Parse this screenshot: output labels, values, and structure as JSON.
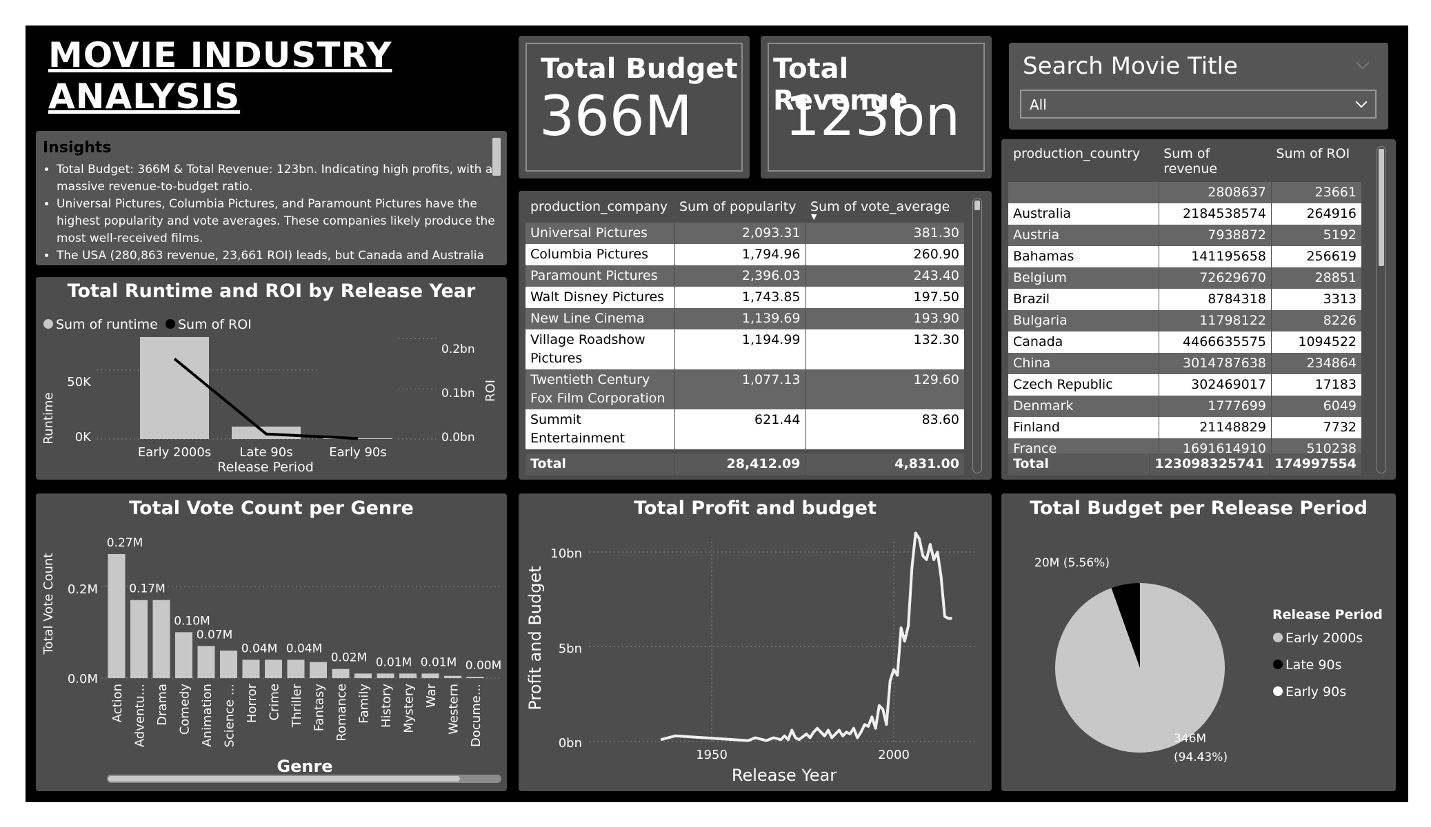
{
  "title": "MOVIE INDUSTRY \nANALYSIS",
  "insights": {
    "heading": "Insights",
    "bullets": [
      "Total Budget: 366M & Total Revenue: 123bn. Indicating high profits, with a massive revenue-to-budget ratio.",
      "Universal Pictures, Columbia Pictures, and Paramount Pictures have the highest popularity and vote averages. These companies likely produce the most well-received films.",
      "The USA (280,863 revenue, 23,661 ROI) leads, but Canada and Australia"
    ]
  },
  "cards": {
    "budget": {
      "label": "Total Budget",
      "value": "366M"
    },
    "revenue": {
      "label": "Total Revenue",
      "value": "123bn"
    }
  },
  "search": {
    "label": "Search Movie Title",
    "selected": "All",
    "chevron_icon": "chevron-down-icon"
  },
  "company_table": {
    "headers": [
      "production_company",
      "Sum of popularity",
      "Sum of vote_average"
    ],
    "rows": [
      [
        "Universal Pictures",
        "2,093.31",
        "381.30"
      ],
      [
        "Columbia Pictures",
        "1,794.96",
        "260.90"
      ],
      [
        "Paramount Pictures",
        "2,396.03",
        "243.40"
      ],
      [
        "Walt Disney Pictures",
        "1,743.85",
        "197.50"
      ],
      [
        "New Line Cinema",
        "1,139.69",
        "193.90"
      ],
      [
        "Village Roadshow Pictures",
        "1,194.99",
        "132.30"
      ],
      [
        "Twentieth Century Fox Film Corporation",
        "1,077.13",
        "129.60"
      ],
      [
        "Summit Entertainment",
        "621.44",
        "83.60"
      ]
    ],
    "total": [
      "Total",
      "28,412.09",
      "4,831.00"
    ]
  },
  "country_table": {
    "headers": [
      "production_country",
      "Sum of revenue",
      "Sum of ROI"
    ],
    "rows": [
      [
        "",
        "2808637",
        "23661"
      ],
      [
        "Australia",
        "2184538574",
        "264916"
      ],
      [
        "Austria",
        "7938872",
        "5192"
      ],
      [
        "Bahamas",
        "141195658",
        "256619"
      ],
      [
        "Belgium",
        "72629670",
        "28851"
      ],
      [
        "Brazil",
        "8784318",
        "3313"
      ],
      [
        "Bulgaria",
        "11798122",
        "8226"
      ],
      [
        "Canada",
        "4466635575",
        "1094522"
      ],
      [
        "China",
        "3014787638",
        "234864"
      ],
      [
        "Czech Republic",
        "302469017",
        "17183"
      ],
      [
        "Denmark",
        "1777699",
        "6049"
      ],
      [
        "Finland",
        "21148829",
        "7732"
      ],
      [
        "France",
        "1691614910",
        "510238"
      ]
    ],
    "total": [
      "Total",
      "123098325741",
      "174997554"
    ]
  },
  "runtime_roi": {
    "title": "Total Runtime and ROI by Release Year",
    "legend": [
      "Sum of runtime",
      "Sum of ROI"
    ],
    "ylabel_left": "Runtime",
    "ylabel_right": "ROI",
    "xlabel": "Release Period",
    "left_ticks": [
      "50K",
      "0K"
    ],
    "right_ticks": [
      "0.2bn",
      "0.1bn",
      "0.0bn"
    ]
  },
  "vote_genre": {
    "title": "Total Vote Count per Genre",
    "ylabel": "Total Vote Count",
    "xlabel": "Genre",
    "ticks": [
      "0.2M",
      "0.0M"
    ]
  },
  "profit_budget": {
    "title": "Total Profit and budget",
    "ylabel": "Profit and Budget",
    "xlabel": "Release Year",
    "y_ticks": [
      "10bn",
      "5bn",
      "0bn"
    ],
    "x_ticks": [
      "1950",
      "2000"
    ]
  },
  "budget_period": {
    "title": "Total Budget per Release Period",
    "legend_title": "Release Period",
    "legend": [
      "Early 2000s",
      "Late 90s",
      "Early 90s"
    ],
    "label_small": "20M (5.56%)",
    "label_big_1": "346M",
    "label_big_2": "(94.43%)"
  },
  "colors": {
    "background": "#000000",
    "panel": "#4d4d4d",
    "bar": "#c8c8c8",
    "line": "#000000",
    "highlight_row": "#ffffff"
  },
  "chart_data": [
    {
      "type": "bar",
      "title": "Total Runtime and ROI by Release Year",
      "categories": [
        "Early 2000s",
        "Late 90s",
        "Early 90s"
      ],
      "series": [
        {
          "name": "Sum of runtime",
          "values": [
            74000,
            9000,
            500
          ]
        },
        {
          "name": "Sum of ROI",
          "values": [
            0.16,
            0.01,
            0.001
          ]
        }
      ],
      "xlabel": "Release Period",
      "ylabel": "Runtime",
      "ylim": [
        0,
        80000
      ],
      "y2label": "ROI",
      "y2lim": [
        0,
        0.22
      ]
    },
    {
      "type": "bar",
      "title": "Total Vote Count per Genre",
      "categories": [
        "Action",
        "Adventu...",
        "Drama",
        "Comedy",
        "Animation",
        "Science ...",
        "Horror",
        "Crime",
        "Thriller",
        "Fantasy",
        "Romance",
        "Family",
        "History",
        "Mystery",
        "War",
        "Western",
        "Docume..."
      ],
      "values": [
        0.27,
        0.17,
        0.17,
        0.1,
        0.07,
        0.06,
        0.04,
        0.04,
        0.04,
        0.035,
        0.02,
        0.01,
        0.01,
        0.01,
        0.01,
        0.005,
        0.003
      ],
      "data_labels": [
        "0.27M",
        "0.17M",
        "",
        "0.10M",
        "0.07M",
        "",
        "0.04M",
        "",
        "0.04M",
        "",
        "0.02M",
        "",
        "0.01M",
        "",
        "0.01M",
        "",
        "0.00M"
      ],
      "xlabel": "Genre",
      "ylabel": "Total Vote Count",
      "ylim": [
        0,
        0.3
      ]
    },
    {
      "type": "line",
      "title": "Total Profit and budget",
      "x": [
        1936,
        1940,
        1960,
        1962,
        1965,
        1967,
        1969,
        1970,
        1971,
        1972,
        1973,
        1974,
        1976,
        1977,
        1978,
        1979,
        1980,
        1981,
        1982,
        1983,
        1984,
        1985,
        1986,
        1987,
        1988,
        1989,
        1990,
        1991,
        1992,
        1993,
        1994,
        1995,
        1996,
        1997,
        1998,
        1999,
        2000,
        2001,
        2002,
        2003,
        2004,
        2005,
        2006,
        2007,
        2008,
        2009,
        2010,
        2011,
        2012,
        2013,
        2014,
        2015,
        2016
      ],
      "values": [
        0.1,
        0.3,
        0.05,
        0.2,
        0.05,
        0.2,
        0.1,
        0.3,
        0.1,
        0.6,
        0.2,
        0.1,
        0.4,
        0.2,
        0.5,
        0.7,
        0.5,
        0.3,
        0.6,
        0.2,
        0.4,
        0.6,
        0.3,
        0.5,
        0.4,
        0.7,
        0.2,
        0.5,
        0.9,
        0.8,
        1.3,
        0.7,
        1.9,
        1.7,
        0.9,
        3.2,
        3.8,
        3.5,
        6.0,
        5.3,
        6.1,
        9.2,
        11.0,
        10.7,
        9.8,
        9.6,
        10.4,
        9.6,
        10.0,
        8.7,
        6.6,
        6.5,
        6.5
      ],
      "xlabel": "Release Year",
      "ylabel": "Profit and Budget",
      "xlim": [
        1935,
        2020
      ],
      "ylim": [
        0,
        11.5
      ]
    },
    {
      "type": "pie",
      "title": "Total Budget per Release Period",
      "categories": [
        "Early 2000s",
        "Late 90s",
        "Early 90s"
      ],
      "values": [
        346,
        20,
        0.03
      ],
      "percent": [
        94.43,
        5.56,
        0.01
      ]
    }
  ]
}
